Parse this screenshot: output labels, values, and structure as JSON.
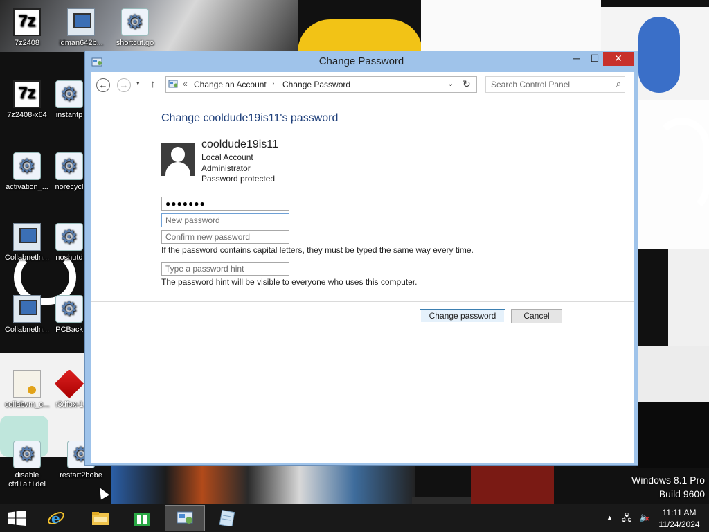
{
  "desktop": {
    "icons": [
      {
        "label": "7z2408",
        "icon": "7zip-icon"
      },
      {
        "label": "idman642b...",
        "icon": "idm-icon"
      },
      {
        "label": "shortcut.go",
        "icon": "gear-icon"
      },
      {
        "label": "7z2408-x64",
        "icon": "7zip-icon"
      },
      {
        "label": "instantp",
        "icon": "gear-icon"
      },
      {
        "label": "activation_...",
        "icon": "gear-icon"
      },
      {
        "label": "norecycl",
        "icon": "gear-icon"
      },
      {
        "label": "Collabnetln...",
        "icon": "computer-icon"
      },
      {
        "label": "noshutd",
        "icon": "gear-icon"
      },
      {
        "label": "Collabnetln...",
        "icon": "computer-icon"
      },
      {
        "label": "PCBack",
        "icon": "gear-icon"
      },
      {
        "label": "collabvm_c...",
        "icon": "certificate-icon"
      },
      {
        "label": "r3dfox-1",
        "icon": "r3dfox-icon"
      },
      {
        "label": "disable ctrl+alt+del",
        "icon": "gear-icon"
      },
      {
        "label": "restart2bobe",
        "icon": "gear-icon"
      }
    ],
    "watermark": {
      "line1": "Windows 8.1 Pro",
      "line2": "Build 9600"
    }
  },
  "window": {
    "title": "Change Password",
    "controls": {
      "minimize": "─",
      "maximize": "☐",
      "close": "✕"
    },
    "nav": {
      "back": "←",
      "forward": "→",
      "dropdown": "▾",
      "up": "↑"
    },
    "address": {
      "overflow": "«",
      "crumbs": [
        "Change an Account",
        "Change Password"
      ],
      "separator": "›",
      "dropdown": "⌄",
      "refresh": "↻"
    },
    "search": {
      "placeholder": "Search Control Panel",
      "icon": "⌕"
    },
    "content": {
      "heading": "Change cooldude19is11's password",
      "account": {
        "name": "cooldude19is11",
        "type": "Local Account",
        "role": "Administrator",
        "status": "Password protected"
      },
      "fields": {
        "current_password": "●●●●●●●",
        "new_password_placeholder": "New password",
        "confirm_placeholder": "Confirm new password",
        "hint_placeholder": "Type a password hint"
      },
      "notes": {
        "caps": "If the password contains capital letters, they must be typed the same way every time.",
        "hint": "The password hint will be visible to everyone who uses this computer."
      },
      "buttons": {
        "change": "Change password",
        "cancel": "Cancel"
      }
    }
  },
  "taskbar": {
    "items": [
      "start",
      "internet-explorer",
      "file-explorer",
      "store",
      "control-panel",
      "notepad"
    ],
    "active": "control-panel",
    "tray": {
      "arrow": "▲",
      "network": "🖧",
      "volume": "🔈",
      "muted": "✕"
    },
    "clock": {
      "time": "11:11 AM",
      "date": "11/24/2024"
    }
  },
  "colors": {
    "window_frame": "#9fc3ea",
    "heading": "#1e3f7a",
    "close_button": "#c7302b",
    "taskbar": "#191919"
  }
}
